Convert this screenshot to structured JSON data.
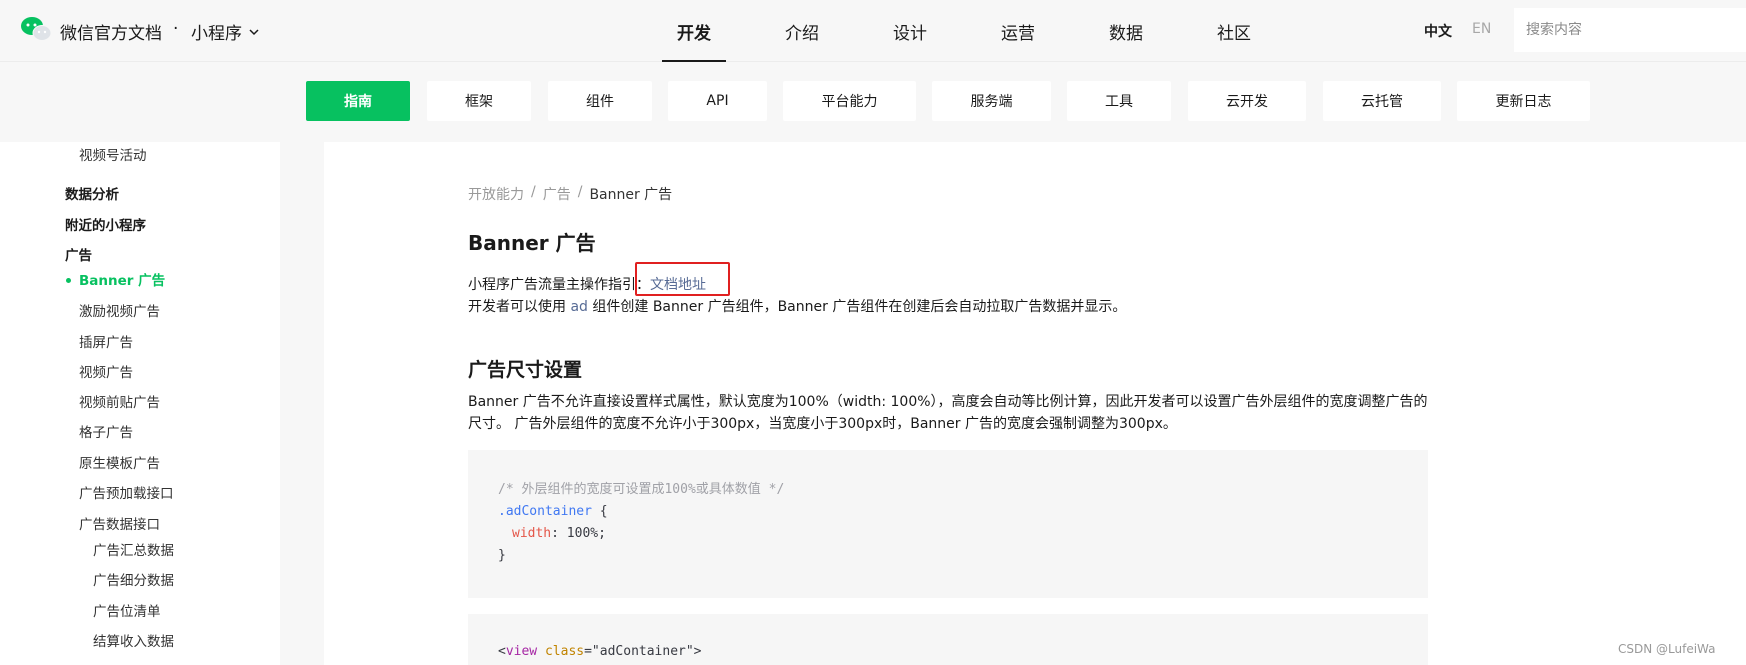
{
  "header": {
    "brand": "微信官方文档",
    "dot": "·",
    "product": "小程序",
    "nav": [
      "开发",
      "介绍",
      "设计",
      "运营",
      "数据",
      "社区"
    ],
    "active_nav": "开发",
    "lang_zh": "中文",
    "lang_en": "EN",
    "search_placeholder": "搜索内容"
  },
  "subnav": {
    "tabs": [
      "指南",
      "框架",
      "组件",
      "API",
      "平台能力",
      "服务端",
      "工具",
      "云开发",
      "云托管",
      "更新日志"
    ],
    "active": "指南"
  },
  "sidebar": {
    "items": [
      {
        "label": "视频号活动",
        "level": 2
      },
      {
        "label": "数据分析",
        "level": 1
      },
      {
        "label": "附近的小程序",
        "level": 1
      },
      {
        "label": "广告",
        "level": 1
      },
      {
        "label": "Banner 广告",
        "level": 2,
        "active": true
      },
      {
        "label": "激励视频广告",
        "level": 2
      },
      {
        "label": "插屏广告",
        "level": 2
      },
      {
        "label": "视频广告",
        "level": 2
      },
      {
        "label": "视频前贴广告",
        "level": 2
      },
      {
        "label": "格子广告",
        "level": 2
      },
      {
        "label": "原生模板广告",
        "level": 2
      },
      {
        "label": "广告预加载接口",
        "level": 2
      },
      {
        "label": "广告数据接口",
        "level": 2
      },
      {
        "label": "广告汇总数据",
        "level": 3
      },
      {
        "label": "广告细分数据",
        "level": 3
      },
      {
        "label": "广告位清单",
        "level": 3
      },
      {
        "label": "结算收入数据",
        "level": 3
      }
    ]
  },
  "content": {
    "breadcrumb": [
      "开放能力",
      "广告",
      "Banner 广告"
    ],
    "breadcrumb_sep": "/",
    "title": "Banner 广告",
    "guide_text": "小程序广告流量主操作指引：",
    "guide_link": "文档地址",
    "intro_before": "开发者可以使用 ",
    "intro_code": "ad",
    "intro_after": " 组件创建 Banner 广告组件，Banner 广告组件在创建后会自动拉取广告数据并显示。",
    "section_title": "广告尺寸设置",
    "section_para": "Banner 广告不允许直接设置样式属性，默认宽度为100%（width: 100%），高度会自动等比例计算，因此开发者可以设置广告外层组件的宽度调整广告的尺寸。 广告外层组件的宽度不允许小于300px，当宽度小于300px时，Banner 广告的宽度会强制调整为300px。",
    "code1": {
      "comment": "/* 外层组件的宽度可设置成100%或具体数值 */",
      "selector": ".adContainer",
      "open_brace": " {",
      "prop": "width",
      "value": ": 100%;",
      "close_brace": "}"
    },
    "code2": {
      "lt": "<",
      "tag": "view",
      "space": " ",
      "attr": "class",
      "rest": "=\"adContainer\">"
    }
  },
  "watermark": "CSDN @LufeiWa",
  "colors": {
    "accent": "#07c160",
    "link": "#576b95",
    "highlight_box": "#e02020"
  }
}
